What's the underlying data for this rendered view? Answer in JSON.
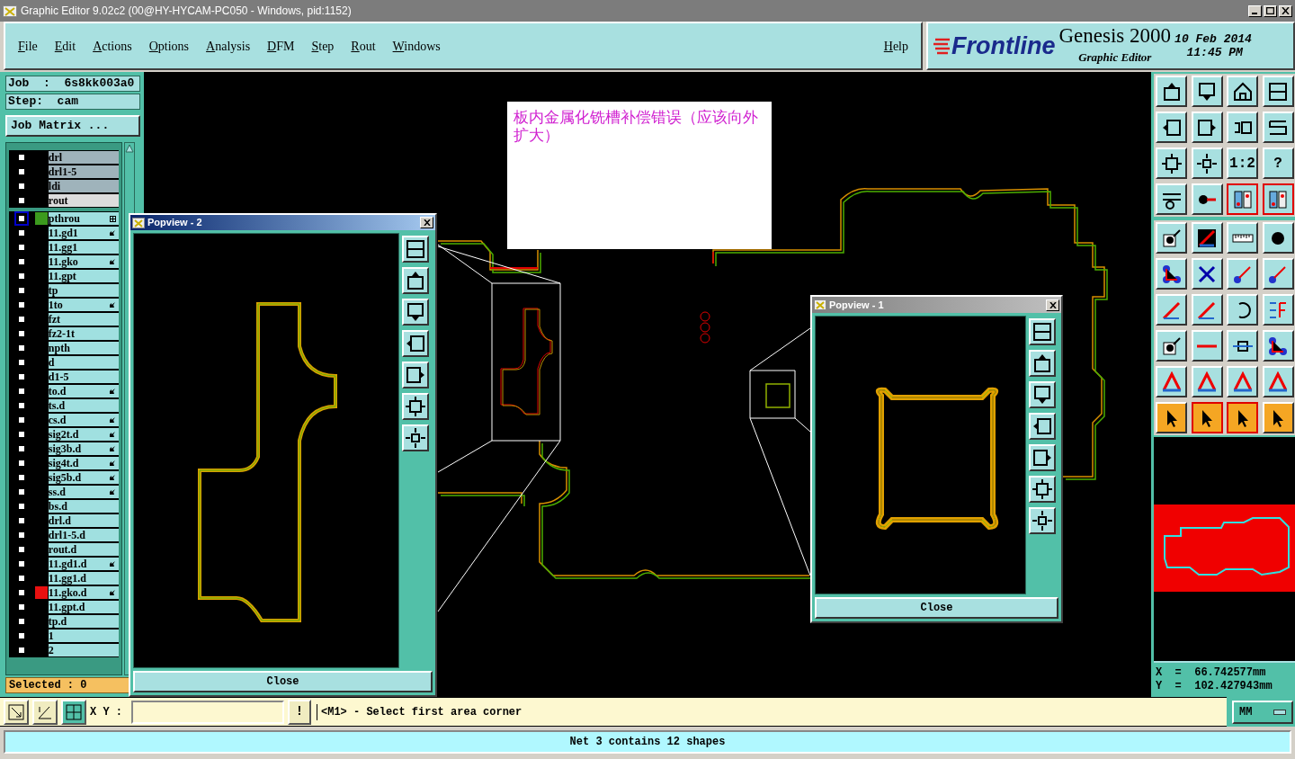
{
  "window": {
    "title": "Graphic Editor 9.02c2 (00@HY-HYCAM-PC050 - Windows, pid:1152)"
  },
  "menu": [
    "File",
    "Edit",
    "Actions",
    "Options",
    "Analysis",
    "DFM",
    "Step",
    "Rout",
    "Windows"
  ],
  "help": "Help",
  "brand": {
    "logo": "Frontline",
    "product": "Genesis 2000",
    "subtitle": "Graphic Editor",
    "date": "10 Feb 2014",
    "time": "11:45 PM"
  },
  "job": {
    "job": "Job  :  6s8kk003a0",
    "step": "Step:  cam",
    "matrix_button": "Job Matrix ..."
  },
  "layer_groups": [
    [
      {
        "name": "drl",
        "kind": "drill",
        "focused": false,
        "edit_mark": false,
        "sub_layers": false
      },
      {
        "name": "drl1-5",
        "kind": "drill",
        "focused": false,
        "edit_mark": false,
        "sub_layers": false
      },
      {
        "name": "ldi",
        "kind": "drill",
        "focused": false,
        "edit_mark": false,
        "sub_layers": false
      },
      {
        "name": "rout",
        "kind": "rout",
        "focused": false,
        "edit_mark": false,
        "sub_layers": false
      }
    ],
    [
      {
        "name": "pthrou",
        "kind": "board",
        "focused": true,
        "color": "#3c9a1e",
        "edit_mark": false,
        "sub_layers": true
      },
      {
        "name": "11.gd1",
        "kind": "board",
        "focused": false,
        "edit_mark": true,
        "sub_layers": false
      },
      {
        "name": "11.gg1",
        "kind": "board",
        "focused": false,
        "edit_mark": false,
        "sub_layers": false
      },
      {
        "name": "11.gko",
        "kind": "board",
        "focused": false,
        "edit_mark": true,
        "sub_layers": false
      },
      {
        "name": "11.gpt",
        "kind": "board",
        "focused": false,
        "edit_mark": false,
        "sub_layers": false
      },
      {
        "name": "tp",
        "kind": "board",
        "focused": false,
        "edit_mark": false,
        "sub_layers": false
      },
      {
        "name": "1to",
        "kind": "board",
        "focused": false,
        "edit_mark": true,
        "sub_layers": false
      },
      {
        "name": "fzt",
        "kind": "board",
        "focused": false,
        "edit_mark": false,
        "sub_layers": false
      },
      {
        "name": "fz2-1t",
        "kind": "board",
        "focused": false,
        "edit_mark": false,
        "sub_layers": false
      },
      {
        "name": "npth",
        "kind": "board",
        "focused": false,
        "edit_mark": false,
        "sub_layers": false
      },
      {
        "name": "d",
        "kind": "board",
        "focused": false,
        "edit_mark": false,
        "sub_layers": false
      },
      {
        "name": "d1-5",
        "kind": "board",
        "focused": false,
        "edit_mark": false,
        "sub_layers": false
      },
      {
        "name": "to.d",
        "kind": "board",
        "focused": false,
        "edit_mark": true,
        "sub_layers": false
      },
      {
        "name": "ts.d",
        "kind": "board",
        "focused": false,
        "edit_mark": false,
        "sub_layers": false
      },
      {
        "name": "cs.d",
        "kind": "board",
        "focused": false,
        "edit_mark": true,
        "sub_layers": false
      },
      {
        "name": "sig2t.d",
        "kind": "board",
        "focused": false,
        "edit_mark": true,
        "sub_layers": false
      },
      {
        "name": "sig3b.d",
        "kind": "board",
        "focused": false,
        "edit_mark": true,
        "sub_layers": false
      },
      {
        "name": "sig4t.d",
        "kind": "board",
        "focused": false,
        "edit_mark": true,
        "sub_layers": false
      },
      {
        "name": "sig5b.d",
        "kind": "board",
        "focused": false,
        "edit_mark": true,
        "sub_layers": false
      },
      {
        "name": "ss.d",
        "kind": "board",
        "focused": false,
        "edit_mark": true,
        "sub_layers": false
      },
      {
        "name": "bs.d",
        "kind": "board",
        "focused": false,
        "edit_mark": false,
        "sub_layers": false
      },
      {
        "name": "drl.d",
        "kind": "board",
        "focused": false,
        "edit_mark": false,
        "sub_layers": false
      },
      {
        "name": "drl1-5.d",
        "kind": "board",
        "focused": false,
        "edit_mark": false,
        "sub_layers": false
      },
      {
        "name": "rout.d",
        "kind": "board",
        "focused": false,
        "edit_mark": false,
        "sub_layers": false
      },
      {
        "name": "11.gd1.d",
        "kind": "board",
        "focused": false,
        "edit_mark": true,
        "sub_layers": false
      },
      {
        "name": "11.gg1.d",
        "kind": "board",
        "focused": false,
        "edit_mark": false,
        "sub_layers": false
      },
      {
        "name": "11.gko.d",
        "kind": "board",
        "focused": false,
        "color": "#e81010",
        "edit_mark": true,
        "sub_layers": false
      },
      {
        "name": "11.gpt.d",
        "kind": "board",
        "focused": false,
        "edit_mark": false,
        "sub_layers": false
      },
      {
        "name": "tp.d",
        "kind": "board",
        "focused": false,
        "edit_mark": false,
        "sub_layers": false
      },
      {
        "name": "1",
        "kind": "board",
        "focused": false,
        "edit_mark": false,
        "sub_layers": false
      },
      {
        "name": "2",
        "kind": "board",
        "focused": false,
        "edit_mark": false,
        "sub_layers": false
      }
    ]
  ],
  "selected": "Selected : 0",
  "annotation": "板内金属化铣槽补偿错误（应该向外扩大）",
  "popviews": [
    {
      "title": "Popview - 2",
      "active": true,
      "close": "Close"
    },
    {
      "title": "Popview - 1",
      "active": false,
      "close": "Close"
    }
  ],
  "tools": [
    {
      "kind": "box-up",
      "active": false
    },
    {
      "kind": "box-down",
      "active": false
    },
    {
      "kind": "house",
      "active": false
    },
    {
      "kind": "panes",
      "active": false
    },
    {
      "kind": "box-left",
      "active": false
    },
    {
      "kind": "box-right",
      "active": false
    },
    {
      "kind": "undo",
      "active": false
    },
    {
      "kind": "lines",
      "active": false
    },
    {
      "kind": "fit",
      "active": false
    },
    {
      "kind": "zoom",
      "active": false
    },
    {
      "kind": "text",
      "label": "1:2",
      "active": false
    },
    {
      "kind": "text",
      "label": "?",
      "active": false
    },
    {
      "kind": "tools",
      "active": false
    },
    {
      "kind": "pin",
      "active": false
    },
    {
      "kind": "layers",
      "active": true
    },
    {
      "kind": "layers",
      "active": true
    },
    {
      "kind": "pick",
      "active": false
    },
    {
      "kind": "slash",
      "active": false
    },
    {
      "kind": "ruler",
      "active": false
    },
    {
      "kind": "dot",
      "active": false
    },
    {
      "kind": "net",
      "active": false
    },
    {
      "kind": "cross",
      "active": false
    },
    {
      "kind": "link",
      "active": false
    },
    {
      "kind": "link",
      "active": false
    },
    {
      "kind": "pen",
      "active": false
    },
    {
      "kind": "pen",
      "active": false
    },
    {
      "kind": "rotate",
      "active": false
    },
    {
      "kind": "flip",
      "active": false
    },
    {
      "kind": "pick",
      "active": false
    },
    {
      "kind": "dash",
      "active": false
    },
    {
      "kind": "measure",
      "active": false
    },
    {
      "kind": "net",
      "active": false
    },
    {
      "kind": "triangle",
      "active": false
    },
    {
      "kind": "triangle",
      "active": false
    },
    {
      "kind": "triangle",
      "active": false
    },
    {
      "kind": "triangle",
      "active": false
    },
    {
      "kind": "pointer",
      "active": false
    },
    {
      "kind": "pointer",
      "active": true
    },
    {
      "kind": "pointer",
      "active": true
    },
    {
      "kind": "pointer",
      "active": false
    }
  ],
  "coordinates": {
    "x": "X  =  66.742577mm",
    "y": "Y  =  102.427943mm"
  },
  "command": {
    "label": "X Y :",
    "alert": "!",
    "message": "<M1> - Select first area corner",
    "units": "MM"
  },
  "status": "Net 3 contains 12 shapes"
}
